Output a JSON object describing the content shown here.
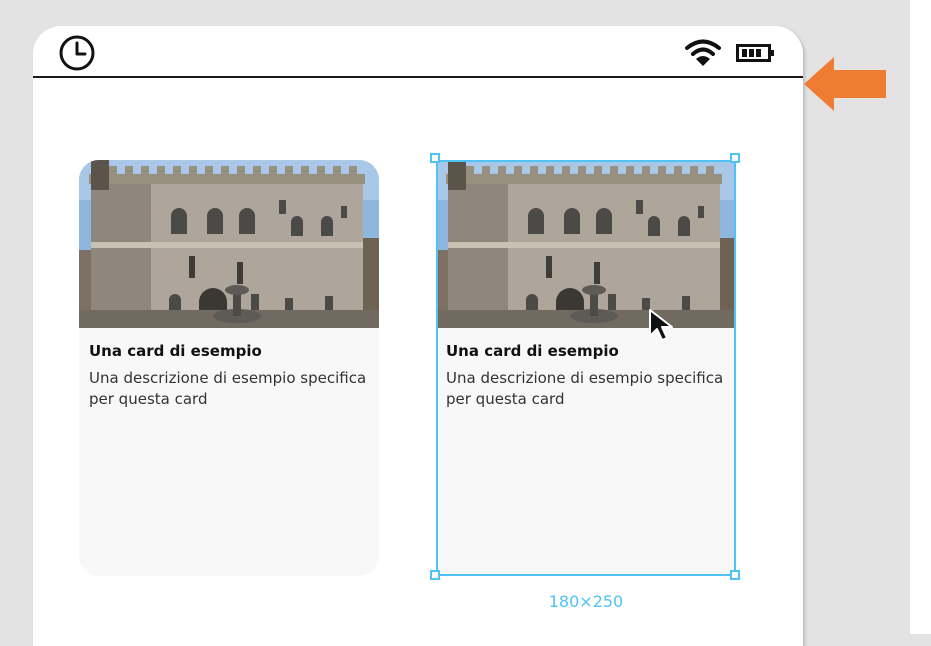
{
  "colors": {
    "background": "#e3e3e3",
    "selection": "#4fc3f7",
    "arrow": "#ee7d31",
    "card_bg": "#f8f8f8"
  },
  "status_bar": {
    "left_icon": "clock-icon",
    "right_icons": [
      "wifi-icon",
      "battery-icon"
    ]
  },
  "cards": [
    {
      "title": "Una card di esempio",
      "description": "Una descrizione di esempio specifica per questa card",
      "image": "palazzo-photo"
    },
    {
      "title": "Una card di esempio",
      "description": "Una descrizione di esempio specifica per questa card",
      "image": "palazzo-photo"
    }
  ],
  "selection": {
    "size_label": "180×250"
  },
  "annotation": {
    "arrow_icon": "left-arrow-icon"
  }
}
